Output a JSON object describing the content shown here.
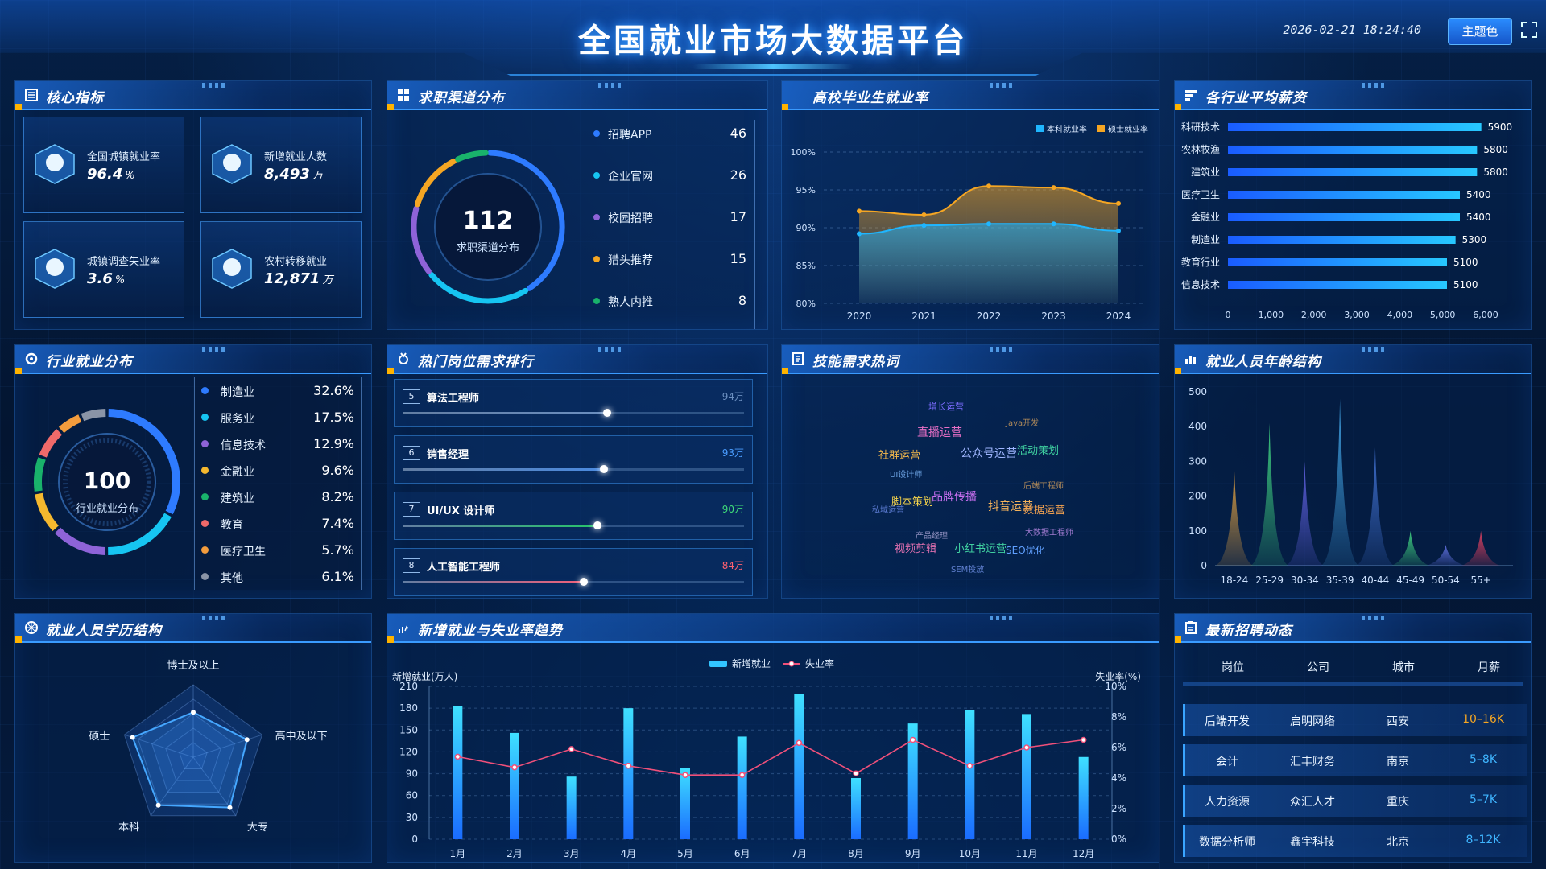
{
  "header": {
    "title": "全国就业市场大数据平台",
    "datetime": "2026-02-21 18:24:40",
    "theme_button": "主题色"
  },
  "core": {
    "title": "核心指标",
    "kpis": [
      {
        "label": "全国城镇就业率",
        "value": "96.4",
        "unit": "%",
        "icon": "bar-chart-icon"
      },
      {
        "label": "新增就业人数",
        "value": "8,493",
        "unit": "万",
        "icon": "user-icon"
      },
      {
        "label": "城镇调查失业率",
        "value": "3.6",
        "unit": "%",
        "icon": "percent-icon"
      },
      {
        "label": "农村转移就业",
        "value": "12,871",
        "unit": "万",
        "icon": "briefcase-icon"
      }
    ]
  },
  "channel": {
    "title": "求职渠道分布",
    "center_value": "112",
    "center_label": "求职渠道分布",
    "items": [
      {
        "name": "招聘APP",
        "value": 46,
        "color": "#2e7bff"
      },
      {
        "name": "企业官网",
        "value": 26,
        "color": "#16c5f2"
      },
      {
        "name": "校园招聘",
        "value": 17,
        "color": "#8e63d8"
      },
      {
        "name": "猎头推荐",
        "value": 15,
        "color": "#f5a623"
      },
      {
        "name": "熟人内推",
        "value": 8,
        "color": "#19b26b"
      }
    ]
  },
  "grad": {
    "title": "高校毕业生就业率",
    "chart_data": {
      "type": "area",
      "x": [
        "2020",
        "2021",
        "2022",
        "2023",
        "2024"
      ],
      "series": [
        {
          "name": "本科就业率",
          "values": [
            89.2,
            90.3,
            90.5,
            90.5,
            89.6
          ],
          "color": "#1fb6ff"
        },
        {
          "name": "硕士就业率",
          "values": [
            92.2,
            91.7,
            95.5,
            95.3,
            93.2
          ],
          "color": "#f5a623"
        }
      ],
      "yticks": [
        "100%",
        "95%",
        "90%",
        "85%",
        "80%"
      ],
      "ylim": [
        80,
        100
      ]
    }
  },
  "salary": {
    "title": "各行业平均薪资",
    "chart_data": {
      "type": "bar",
      "categories": [
        "科研技术",
        "农林牧渔",
        "建筑业",
        "医疗卫生",
        "金融业",
        "制造业",
        "教育行业",
        "信息技术"
      ],
      "values": [
        5900,
        5800,
        5800,
        5400,
        5400,
        5300,
        5100,
        5100
      ],
      "xticks": [
        "0",
        "1,000",
        "2,000",
        "3,000",
        "4,000",
        "5,000",
        "6,000"
      ],
      "xlim": [
        0,
        6000
      ]
    }
  },
  "industry": {
    "title": "行业就业分布",
    "center_value": "100",
    "center_label": "行业就业分布",
    "items": [
      {
        "name": "制造业",
        "value": "32.6%",
        "pct": 32.6,
        "color": "#2e7bff"
      },
      {
        "name": "服务业",
        "value": "17.5%",
        "pct": 17.5,
        "color": "#16c5f2"
      },
      {
        "name": "信息技术",
        "value": "12.9%",
        "pct": 12.9,
        "color": "#8e63d8"
      },
      {
        "name": "金融业",
        "value": "9.6%",
        "pct": 9.6,
        "color": "#f5b82e"
      },
      {
        "name": "建筑业",
        "value": "8.2%",
        "pct": 8.2,
        "color": "#19b26b"
      },
      {
        "name": "教育",
        "value": "7.4%",
        "pct": 7.4,
        "color": "#f06a6a"
      },
      {
        "name": "医疗卫生",
        "value": "5.7%",
        "pct": 5.7,
        "color": "#f39c3d"
      },
      {
        "name": "其他",
        "value": "6.1%",
        "pct": 6.1,
        "color": "#8a94a6"
      }
    ]
  },
  "jobs": {
    "title": "热门岗位需求排行",
    "items": [
      {
        "rank": "5",
        "name": "算法工程师",
        "count": "94万",
        "pct": 0.6,
        "color": "#6b8fc0",
        "count_color": "#6b8fc0"
      },
      {
        "rank": "6",
        "name": "销售经理",
        "count": "93万",
        "pct": 0.59,
        "color": "#4a8ae0",
        "count_color": "#4a9cff"
      },
      {
        "rank": "7",
        "name": "UI/UX 设计师",
        "count": "90万",
        "pct": 0.57,
        "color": "#27c46b",
        "count_color": "#3fdc7a"
      },
      {
        "rank": "8",
        "name": "人工智能工程师",
        "count": "84万",
        "pct": 0.53,
        "color": "#f0607a",
        "count_color": "#ff6070"
      }
    ]
  },
  "skills": {
    "title": "技能需求热词",
    "words": [
      {
        "t": "增长运营",
        "c": "#7b6cff",
        "s": 11
      },
      {
        "t": "社群运营",
        "c": "#f2b84b",
        "s": 13
      },
      {
        "t": "直播运营",
        "c": "#e86fc6",
        "s": 14
      },
      {
        "t": "公众号运营",
        "c": "#9fb6ff",
        "s": 14
      },
      {
        "t": "活动策划",
        "c": "#3fd0a0",
        "s": 13
      },
      {
        "t": "Java开发",
        "c": "#b08a5a",
        "s": 10
      },
      {
        "t": "后端工程师",
        "c": "#b08a5a",
        "s": 10
      },
      {
        "t": "脚本策划",
        "c": "#f5d34b",
        "s": 13
      },
      {
        "t": "品牌传播",
        "c": "#c86ff0",
        "s": 14
      },
      {
        "t": "抖音运营",
        "c": "#f5b35b",
        "s": 14
      },
      {
        "t": "数据运营",
        "c": "#f0a050",
        "s": 13
      },
      {
        "t": "私域运营",
        "c": "#5a7ad0",
        "s": 10
      },
      {
        "t": "UI设计师",
        "c": "#6aa0e0",
        "s": 10
      },
      {
        "t": "大数据工程师",
        "c": "#a07ad0",
        "s": 10
      },
      {
        "t": "视频剪辑",
        "c": "#e070b0",
        "s": 13
      },
      {
        "t": "小红书运营",
        "c": "#40d0a0",
        "s": 13
      },
      {
        "t": "SEO优化",
        "c": "#60a0ff",
        "s": 12
      },
      {
        "t": "产品经理",
        "c": "#9090c0",
        "s": 10
      },
      {
        "t": "SEM投放",
        "c": "#6080d0",
        "s": 10
      }
    ]
  },
  "age": {
    "title": "就业人员年龄结构",
    "chart_data": {
      "type": "area",
      "categories": [
        "18-24",
        "25-29",
        "30-34",
        "35-39",
        "40-44",
        "45-49",
        "50-54",
        "55+"
      ],
      "values": [
        280,
        410,
        300,
        480,
        340,
        100,
        60,
        100
      ],
      "colors": [
        "#e0a040",
        "#3fd080",
        "#6060e0",
        "#40a0e0",
        "#4070d0",
        "#40d080",
        "#6070e0",
        "#e04060"
      ],
      "yticks": [
        "500",
        "400",
        "300",
        "200",
        "100",
        "0"
      ],
      "ylim": [
        0,
        500
      ]
    }
  },
  "edu": {
    "title": "就业人员学历结构",
    "chart_data": {
      "type": "radar",
      "categories": [
        "博士及以上",
        "高中及以下",
        "大专",
        "本科",
        "硕士"
      ],
      "values": [
        0.62,
        0.78,
        0.86,
        0.82,
        0.88
      ],
      "max": 1
    }
  },
  "trend": {
    "title": "新增就业与失业率趋势",
    "legend_bar": "新增就业",
    "legend_line": "失业率",
    "left_label": "新增就业(万人)",
    "right_label": "失业率(%)",
    "chart_data": {
      "type": "bar",
      "categories": [
        "1月",
        "2月",
        "3月",
        "4月",
        "5月",
        "6月",
        "7月",
        "8月",
        "9月",
        "10月",
        "11月",
        "12月"
      ],
      "series": [
        {
          "name": "新增就业",
          "values": [
            183,
            146,
            86,
            180,
            98,
            141,
            200,
            84,
            159,
            177,
            172,
            113
          ]
        },
        {
          "name": "失业率",
          "values": [
            5.4,
            4.7,
            5.9,
            4.8,
            4.2,
            4.2,
            6.3,
            4.3,
            6.5,
            4.8,
            6.0,
            6.5
          ]
        }
      ],
      "yticks_left": [
        "210",
        "180",
        "150",
        "120",
        "90",
        "60",
        "30",
        "0"
      ],
      "yticks_right": [
        "10%",
        "8%",
        "6%",
        "4%",
        "2%",
        "0%"
      ],
      "ylim_left": [
        0,
        210
      ],
      "ylim_right": [
        0,
        10
      ]
    }
  },
  "recruit": {
    "title": "最新招聘动态",
    "headers": [
      "岗位",
      "公司",
      "城市",
      "月薪"
    ],
    "rows": [
      {
        "job": "后端开发",
        "company": "启明网络",
        "city": "西安",
        "salary": "10–16K",
        "color": "#f5a623"
      },
      {
        "job": "会计",
        "company": "汇丰财务",
        "city": "南京",
        "salary": "5–8K",
        "color": "#3fb5ff"
      },
      {
        "job": "人力资源",
        "company": "众汇人才",
        "city": "重庆",
        "salary": "5–7K",
        "color": "#3fb5ff"
      },
      {
        "job": "数据分析师",
        "company": "鑫宇科技",
        "city": "北京",
        "salary": "8–12K",
        "color": "#3fb5ff"
      }
    ]
  }
}
